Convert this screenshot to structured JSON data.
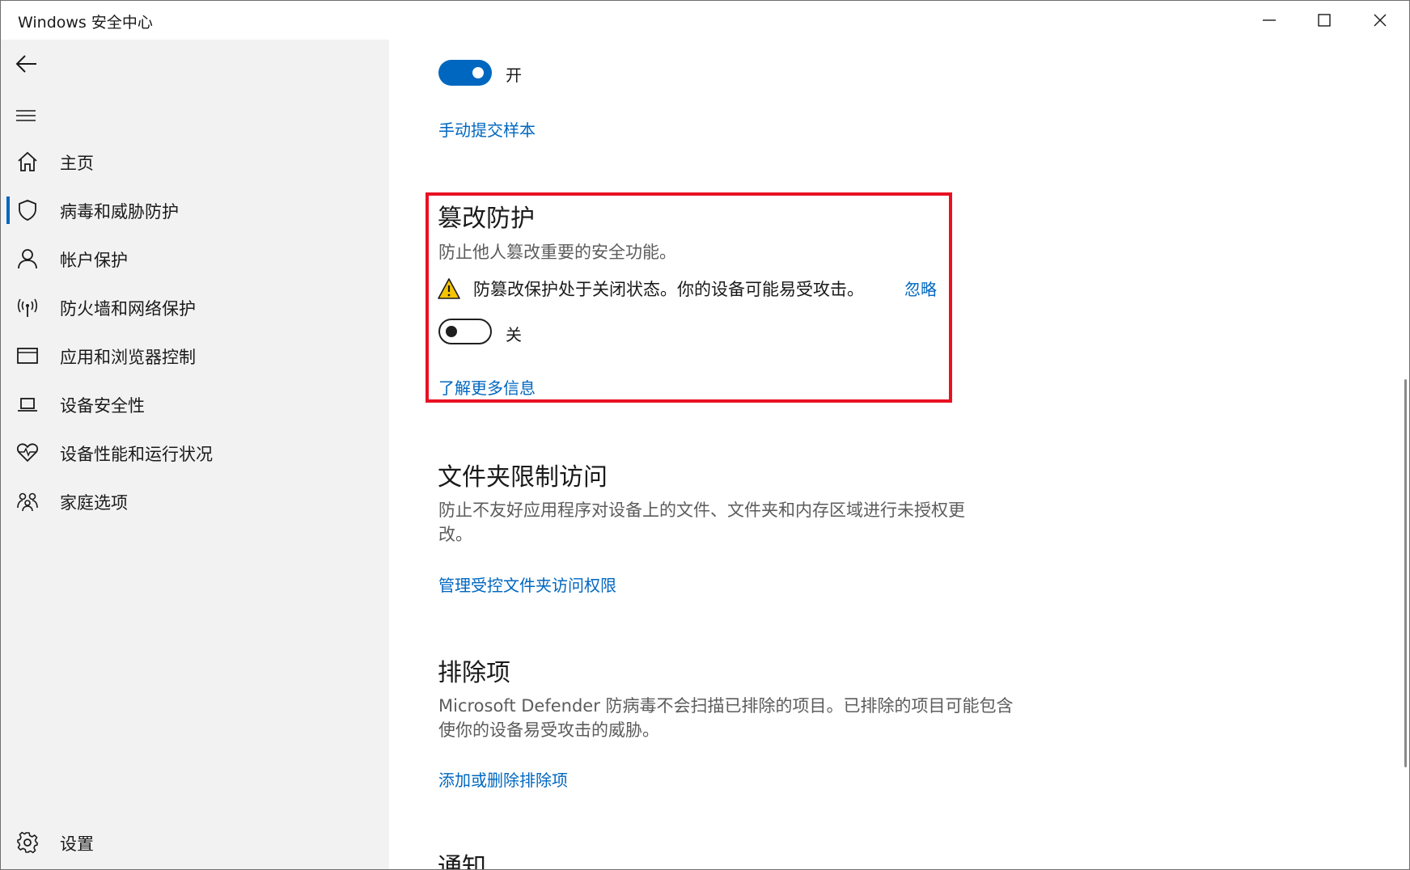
{
  "window": {
    "title": "Windows 安全中心"
  },
  "sidebar": {
    "items": [
      {
        "label": "主页",
        "icon": "home-icon",
        "active": false
      },
      {
        "label": "病毒和威胁防护",
        "icon": "shield-icon",
        "active": true
      },
      {
        "label": "帐户保护",
        "icon": "person-icon",
        "active": false
      },
      {
        "label": "防火墙和网络保护",
        "icon": "wifi-signal-icon",
        "active": false
      },
      {
        "label": "应用和浏览器控制",
        "icon": "browser-window-icon",
        "active": false
      },
      {
        "label": "设备安全性",
        "icon": "laptop-icon",
        "active": false
      },
      {
        "label": "设备性能和运行状况",
        "icon": "heart-pulse-icon",
        "active": false
      },
      {
        "label": "家庭选项",
        "icon": "family-icon",
        "active": false
      }
    ],
    "settings_label": "设置"
  },
  "main": {
    "top_toggle": {
      "state_label": "开",
      "on": true
    },
    "submit_sample_link": "手动提交样本",
    "tamper": {
      "title": "篡改防护",
      "description": "防止他人篡改重要的安全功能。",
      "warning": "防篡改保护处于关闭状态。你的设备可能易受攻击。",
      "ignore_link": "忽略",
      "toggle_state_label": "关",
      "toggle_on": false,
      "learn_more_link": "了解更多信息"
    },
    "folder_access": {
      "title": "文件夹限制访问",
      "description": "防止不友好应用程序对设备上的文件、文件夹和内存区域进行未授权更改。",
      "manage_link": "管理受控文件夹访问权限"
    },
    "exclusions": {
      "title": "排除项",
      "description": "Microsoft Defender 防病毒不会扫描已排除的项目。已排除的项目可能包含使你的设备易受攻击的威胁。",
      "add_remove_link": "添加或删除排除项"
    },
    "notifications": {
      "title": "通知"
    }
  },
  "colors": {
    "accent": "#0067c0",
    "highlight": "#e81123",
    "warning": "#f5c400",
    "sidebar_bg": "#f2f2f2"
  }
}
